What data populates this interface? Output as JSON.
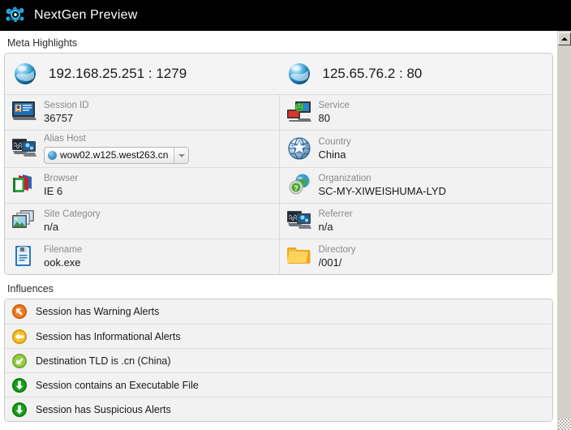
{
  "window": {
    "title": "NextGen Preview",
    "icon": "molecule-icon",
    "titlebar_bg": "#000000",
    "title_color": "#ffffff"
  },
  "sections": {
    "meta": {
      "title": "Meta Highlights",
      "endpoints": {
        "source": {
          "icon": "globe-icon",
          "text": "192.168.25.251 : 1279"
        },
        "destination": {
          "icon": "globe-icon",
          "text": "125.65.76.2 : 80"
        }
      },
      "rows": [
        {
          "left": {
            "icon": "id-card-icon",
            "label": "Session ID",
            "value": "36757"
          },
          "right": {
            "icon": "service-monitor-icon",
            "label": "Service",
            "value": "80"
          }
        },
        {
          "left": {
            "icon": "alias-host-icon",
            "label": "Alias Host",
            "value": "wow02.w125.west263.cn",
            "control": "combobox"
          },
          "right": {
            "icon": "wire-globe-icon",
            "label": "Country",
            "value": "China"
          }
        },
        {
          "left": {
            "icon": "books-icon",
            "label": "Browser",
            "value": "IE 6"
          },
          "right": {
            "icon": "globe-question-icon",
            "label": "Organization",
            "value": "SC-MY-XIWEISHUMA-LYD"
          }
        },
        {
          "left": {
            "icon": "images-icon",
            "label": "Site Category",
            "value": "n/a"
          },
          "right": {
            "icon": "referrer-monitor-icon",
            "label": "Referrer",
            "value": "n/a"
          }
        },
        {
          "left": {
            "icon": "document-icon",
            "label": "Filename",
            "value": "ook.exe"
          },
          "right": {
            "icon": "folder-icon",
            "label": "Directory",
            "value": "/001/"
          }
        }
      ]
    },
    "influences": {
      "title": "Influences",
      "items": [
        {
          "icon": "arrow-up-left-circle-icon",
          "color": "#e8660f",
          "text": "Session has Warning Alerts"
        },
        {
          "icon": "arrow-left-circle-icon",
          "color": "#f0b915",
          "text": "Session has Informational Alerts"
        },
        {
          "icon": "arrow-down-left-circle-icon",
          "color": "#8cc63f",
          "text": "Destination TLD is .cn (China)"
        },
        {
          "icon": "arrow-down-circle-icon",
          "color": "#169b16",
          "text": "Session contains an Executable File"
        },
        {
          "icon": "arrow-down-circle-icon",
          "color": "#169b16",
          "text": "Session has Suspicious Alerts"
        }
      ]
    }
  },
  "scrollbar": {
    "up_button": "scroll-up-arrow",
    "orientation": "vertical"
  }
}
